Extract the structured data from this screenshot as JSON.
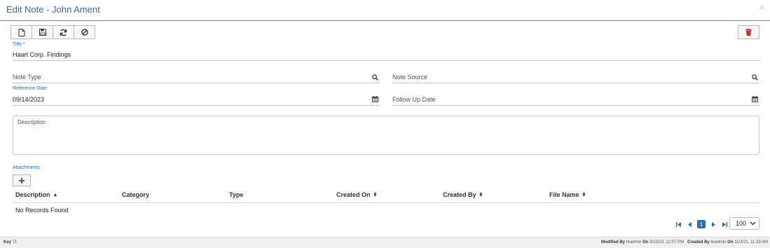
{
  "window": {
    "title": "Edit Note - John Ament",
    "close_glyph": "×"
  },
  "toolbar": {
    "buttons": [
      {
        "name": "new-button",
        "icon": "file-icon"
      },
      {
        "name": "save-button",
        "icon": "floppy-disk-icon"
      },
      {
        "name": "refresh-button",
        "icon": "refresh-icon"
      },
      {
        "name": "cancel-button",
        "icon": "ban-icon"
      }
    ],
    "delete_icon": "trash-icon"
  },
  "form": {
    "title": {
      "label": "Title *",
      "value": "Haart Corp. Findings"
    },
    "note_type": {
      "placeholder": "Note Type",
      "icon": "search-icon"
    },
    "note_source": {
      "placeholder": "Note Source",
      "icon": "search-icon"
    },
    "reference_date": {
      "label": "Reference Date",
      "value": "09/14/2023",
      "icon": "calendar-icon"
    },
    "follow_up_date": {
      "placeholder": "Follow Up Date",
      "icon": "calendar-icon"
    },
    "description": {
      "placeholder": "Description"
    }
  },
  "attachments": {
    "label": "Attachments",
    "add_icon": "plus-icon",
    "columns": [
      {
        "label": "Description",
        "sort": "▲"
      },
      {
        "label": "Category",
        "sort": ""
      },
      {
        "label": "Type",
        "sort": ""
      },
      {
        "label": "Created On",
        "sort": "⬍"
      },
      {
        "label": "Created By",
        "sort": "⬍"
      },
      {
        "label": "File Name",
        "sort": "⬍"
      }
    ],
    "empty_text": "No Records Found"
  },
  "pagination": {
    "current_page": "1",
    "page_size": "100"
  },
  "footer": {
    "key_label": "Key",
    "key_value": "71",
    "modified_by_label": "Modified By",
    "modified_by": "hradmin",
    "modified_on_label": "On",
    "modified_on": "3/15/23, 12:07 PM",
    "created_by_label": "Created By",
    "created_by": "lwadmin",
    "created_on_label": "On",
    "created_on": "11/3/21, 11:29 AM"
  },
  "colors": {
    "accent": "#2a6fb5",
    "delete": "#c9302c",
    "add": "#2e7d32",
    "border": "#c8c8c8",
    "footer_bg": "#f0f0f0"
  }
}
